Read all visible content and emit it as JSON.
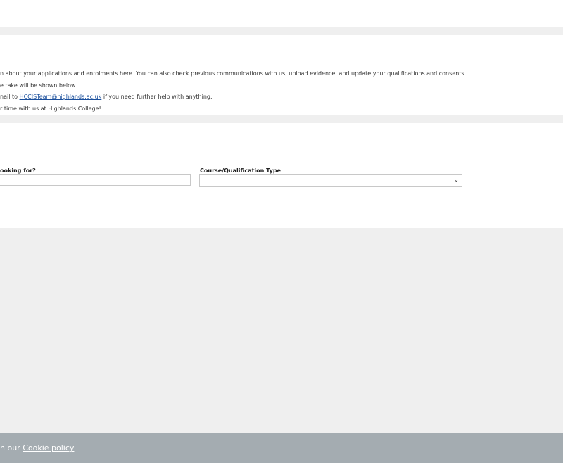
{
  "info": {
    "line1": "n about your applications and enrolments here. You can also check previous communications with us, upload evidence, and update your qualifications and consents.",
    "line2": "e take will be shown below.",
    "line3_prefix": "nail to ",
    "line3_link": "HCCISTeam@highlands.ac.uk",
    "line3_suffix": " if you need further help with anything.",
    "line4": "r time with us at Highlands College!"
  },
  "search": {
    "looking_for_label": "ooking for?",
    "looking_for_value": "",
    "course_type_label": "Course/Qualification Type",
    "course_type_value": ""
  },
  "footer": {
    "text_prefix": "n our ",
    "cookie_link": "Cookie policy"
  }
}
